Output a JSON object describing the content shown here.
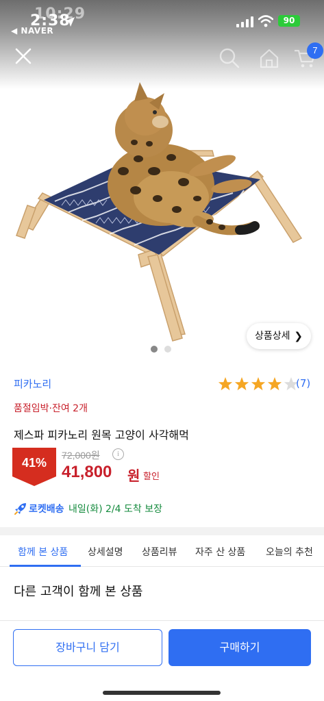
{
  "status_bar": {
    "time": "2:38",
    "ghost_time": "10:29",
    "back_app": "◀ NAVER",
    "battery": "90"
  },
  "header": {
    "icons": [
      "close-icon",
      "search-icon",
      "home-icon",
      "cart-icon"
    ],
    "cart_count": "7"
  },
  "gallery": {
    "detail_button": "상품상세",
    "image_count": 2,
    "current_image": 1
  },
  "product": {
    "seller": "피카노리",
    "rating": 4,
    "rating_max": 5,
    "review_count": "(7)",
    "stock_notice": "품절임박·잔여 2개",
    "name": "제스파 피카노리 원목 고양이 사각해먹",
    "discount": "41%",
    "original_price": "72,000원",
    "price": "41,800",
    "price_unit": "원",
    "price_suffix": "할인"
  },
  "delivery": {
    "label": "로켓배송",
    "eta": "내일(화) 2/4 도착 보장"
  },
  "tabs": [
    {
      "label": "함께 본 상품",
      "active": true
    },
    {
      "label": "상세설명",
      "active": false
    },
    {
      "label": "상품리뷰",
      "active": false
    },
    {
      "label": "자주 산 상품",
      "active": false
    },
    {
      "label": "오늘의 추천",
      "active": false
    }
  ],
  "section": {
    "title": "다른 고객이 함께 본 상품"
  },
  "actions": {
    "cart_button": "장바구니 담기",
    "buy_button": "구매하기"
  },
  "colors": {
    "accent": "#2f6ef2",
    "sale": "#c8202b",
    "delivery_green": "#138a3c"
  }
}
